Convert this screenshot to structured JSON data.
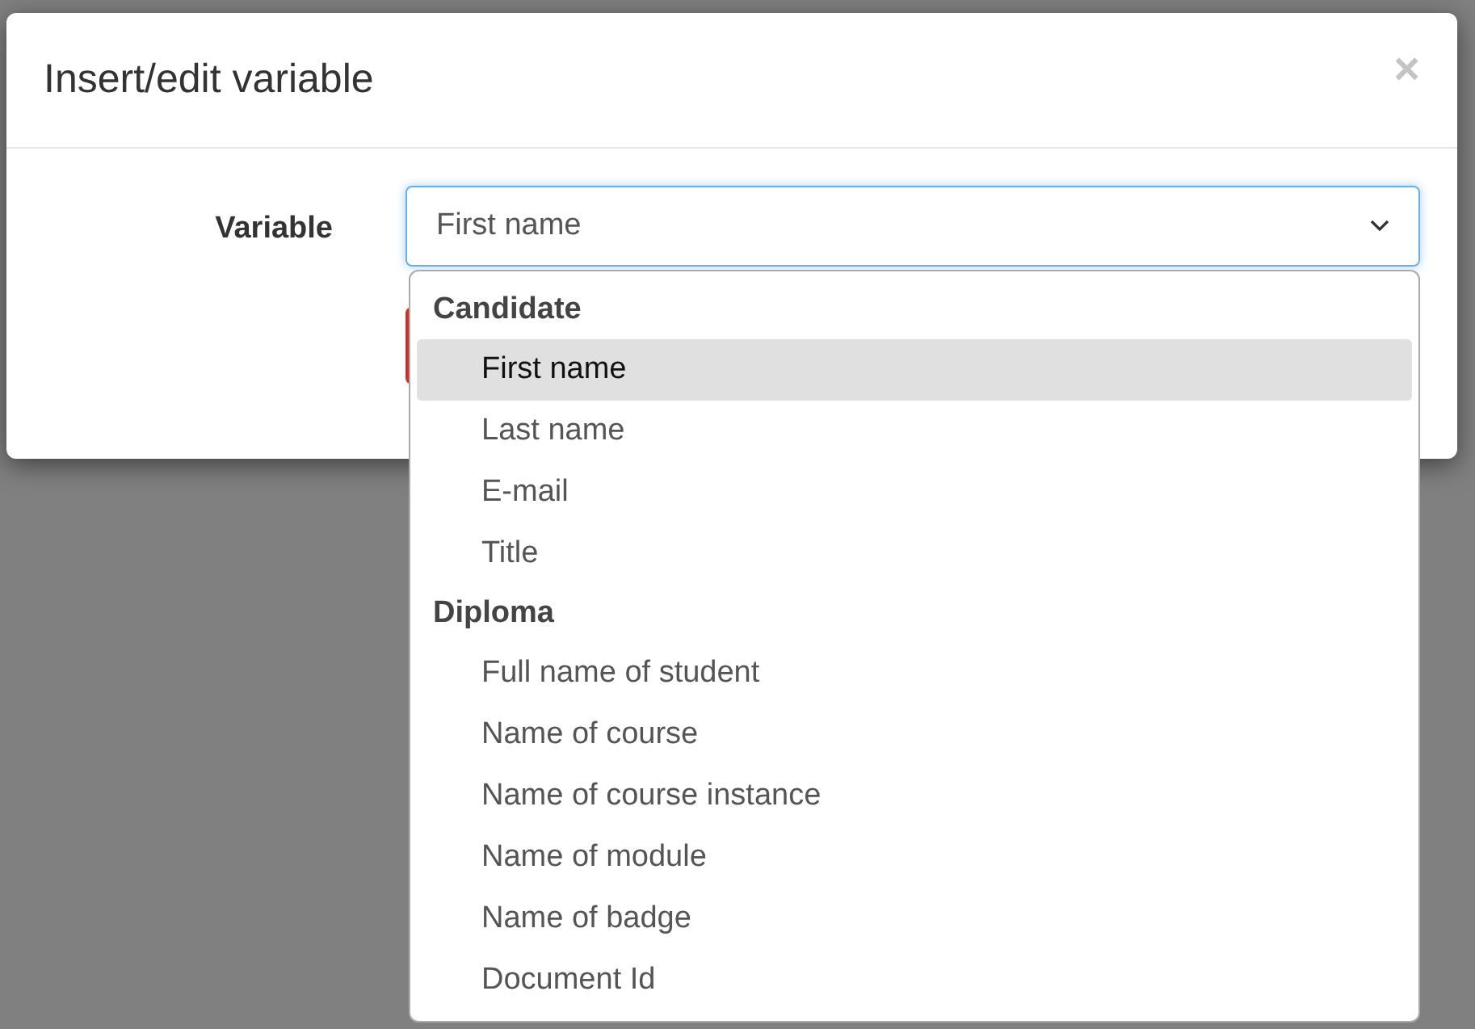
{
  "dialog": {
    "title": "Insert/edit variable",
    "close": "×"
  },
  "field": {
    "label": "Variable",
    "value": "First name"
  },
  "dropdown": {
    "groups": [
      {
        "label": "Candidate",
        "options": [
          {
            "label": "First name",
            "selected": true
          },
          {
            "label": "Last name",
            "selected": false
          },
          {
            "label": "E-mail",
            "selected": false
          },
          {
            "label": "Title",
            "selected": false
          }
        ]
      },
      {
        "label": "Diploma",
        "options": [
          {
            "label": "Full name of student",
            "selected": false
          },
          {
            "label": "Name of course",
            "selected": false
          },
          {
            "label": "Name of course instance",
            "selected": false
          },
          {
            "label": "Name of module",
            "selected": false
          },
          {
            "label": "Name of badge",
            "selected": false
          },
          {
            "label": "Document Id",
            "selected": false
          }
        ]
      }
    ]
  }
}
